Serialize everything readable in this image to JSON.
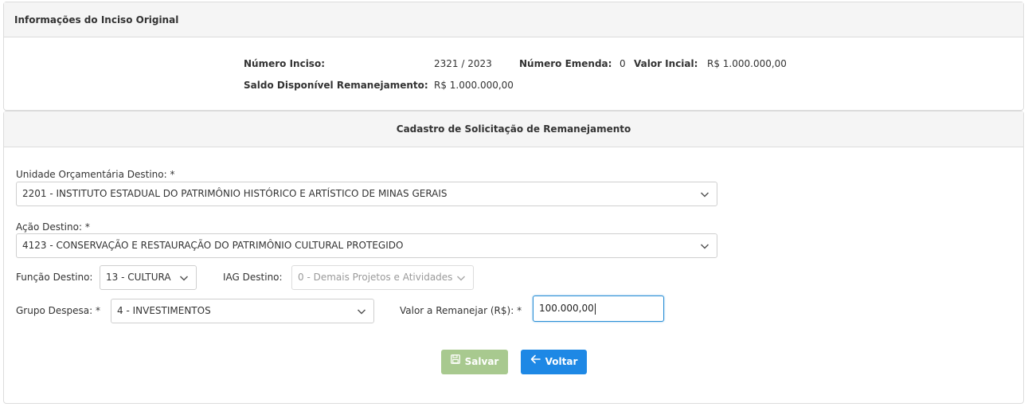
{
  "info": {
    "title": "Informações do Inciso Original",
    "numero_inciso_label": "Número Inciso:",
    "numero_inciso_value": "2321 / 2023",
    "numero_emenda_label": "Número Emenda:",
    "numero_emenda_value": "0",
    "valor_inicial_label": "Valor Incial:",
    "valor_inicial_value": "R$ 1.000.000,00",
    "saldo_label": "Saldo Disponível Remanejamento:",
    "saldo_value": "R$ 1.000.000,00"
  },
  "form": {
    "title": "Cadastro de Solicitação de Remanejamento",
    "unidade_label": "Unidade Orçamentária Destino: *",
    "unidade_value": "2201 - INSTITUTO ESTADUAL DO PATRIMÔNIO HISTÓRICO E ARTÍSTICO DE MINAS GERAIS",
    "acao_label": "Ação Destino: *",
    "acao_value": "4123 - CONSERVAÇÃO E RESTAURAÇÃO DO PATRIMÔNIO CULTURAL PROTEGIDO",
    "funcao_label": "Função Destino:",
    "funcao_value": "13 - CULTURA",
    "iag_label": "IAG Destino:",
    "iag_value": "0 - Demais Projetos e Atividades",
    "grupo_label": "Grupo Despesa: *",
    "grupo_value": "4 - INVESTIMENTOS",
    "valor_label": "Valor a Remanejar (R$): *",
    "valor_value": "100.000,00",
    "save_label": "Salvar",
    "back_label": "Voltar"
  },
  "icons": {
    "save": "floppy-disk-icon",
    "back": "arrow-left-icon",
    "dropdown": "chevron-down-icon"
  },
  "colors": {
    "save_button": "#a8c98f",
    "back_button": "#1e88e5",
    "input_focus_border": "#2b8fd6",
    "panel_header": "#f5f5f5"
  }
}
